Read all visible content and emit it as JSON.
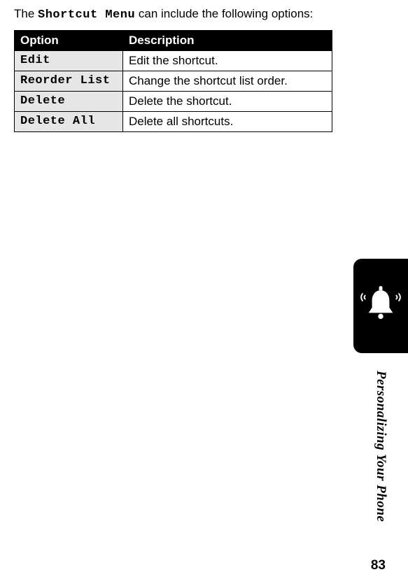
{
  "intro": {
    "prefix": "The ",
    "menu_name": "Shortcut Menu",
    "suffix": " can include the following options:"
  },
  "table": {
    "headers": {
      "option": "Option",
      "description": "Description"
    },
    "rows": [
      {
        "option": "Edit",
        "description": "Edit the shortcut."
      },
      {
        "option": "Reorder List",
        "description": "Change the shortcut list order."
      },
      {
        "option": "Delete",
        "description": "Delete the shortcut."
      },
      {
        "option": "Delete All",
        "description": "Delete all shortcuts."
      }
    ]
  },
  "section_title": "Personalizing Your Phone",
  "page_number": "83"
}
